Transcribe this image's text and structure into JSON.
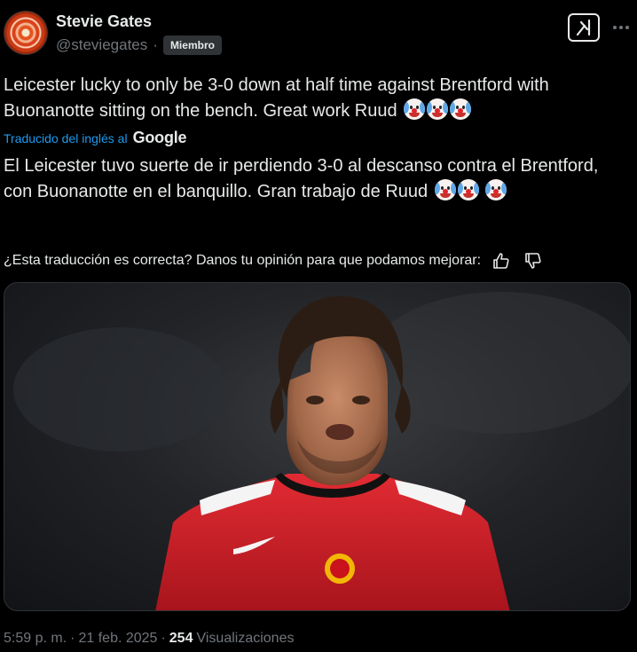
{
  "author": {
    "name": "Stevie Gates",
    "handle": "@steviegates",
    "separator": "·",
    "badge": "Miembro"
  },
  "icons": {
    "grok": "grok-icon",
    "more": "more-horizontal-icon",
    "thumb_up": "thumbs-up-icon",
    "thumb_down": "thumbs-down-icon",
    "clown_emoji": "clown-face-emoji"
  },
  "post": {
    "original_text": "Leicester lucky to only be 3-0 down at half time against Brentford with Buonanotte sitting on the bench. Great work Ruud",
    "translated_by_label": "Traducido del inglés al",
    "translator_brand": "Google",
    "translated_text": "El Leicester tuvo suerte de ir perdiendo 3-0 al descanso contra el Brentford, con Buonanotte en el banquillo. Gran trabajo de Ruud",
    "feedback_question": "¿Esta traducción es correcta? Danos tu opinión para que podamos mejorar:"
  },
  "meta": {
    "time": "5:59 p. m.",
    "sep1": "·",
    "date": "21 feb. 2025",
    "sep2": "·",
    "views_count": "254",
    "views_label": "Visualizaciones"
  },
  "colors": {
    "background": "#000000",
    "text_primary": "#e7e9ea",
    "text_secondary": "#71767b",
    "link": "#1d9bf0",
    "badge_bg": "#2f3336",
    "jersey_red": "#d21f2a"
  }
}
